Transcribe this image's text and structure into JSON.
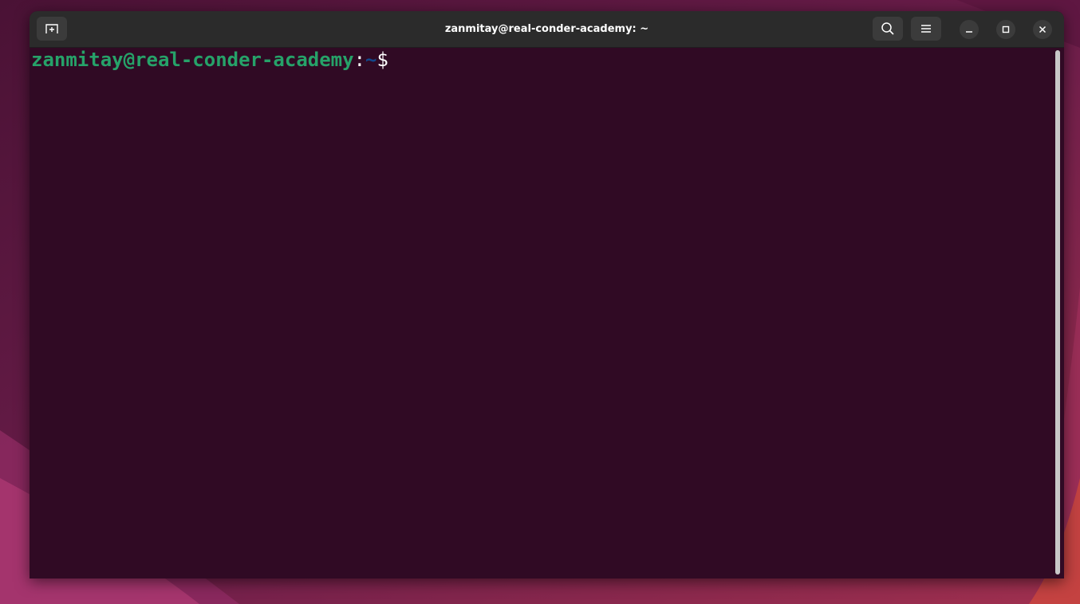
{
  "window": {
    "title": "zanmitay@real-conder-academy: ~"
  },
  "toolbar": {
    "new_tab_icon": "new-tab-icon",
    "search_icon": "search-icon",
    "menu_icon": "hamburger-menu-icon",
    "minimize_icon": "minimize-icon",
    "maximize_icon": "maximize-icon",
    "close_icon": "close-icon"
  },
  "terminal": {
    "prompt_user_host": "zanmitay@real-conder-academy",
    "prompt_colon": ":",
    "prompt_path": "~",
    "prompt_symbol": "$",
    "input": ""
  },
  "colors": {
    "terminal_bg": "#300a24",
    "titlebar_bg": "#2b2b2b",
    "user_host": "#26a269",
    "path": "#12488b",
    "text": "#ffffff"
  }
}
